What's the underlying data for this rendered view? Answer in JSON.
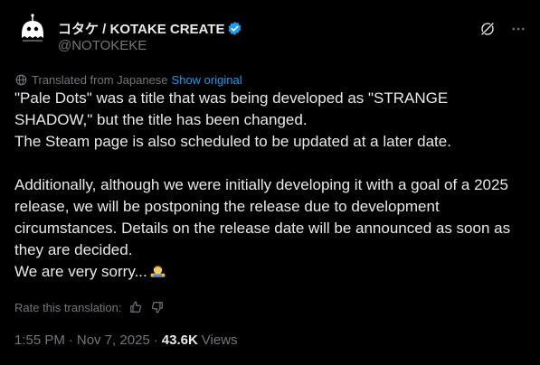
{
  "author": {
    "display_name": "コタケ / KOTAKE CREATE",
    "handle": "@NOTOKEKE",
    "verified_color": "#1d9bf0"
  },
  "translation": {
    "label": "Translated from Japanese",
    "show_original": "Show original"
  },
  "post": {
    "line1": "\"Pale Dots\" was a title that was being developed as \"STRANGE SHADOW,\" but the title has been changed.",
    "line2": "The Steam page is also scheduled to be updated at a later date.",
    "line3": "Additionally, although we were initially developing it with a goal of a 2025 release, we will be postponing the release due to development circumstances. Details on the release date will be announced as soon as they are decided.",
    "line4": "We are very sorry...",
    "emoji": "person-bowing-emoji"
  },
  "rating": {
    "label": "Rate this translation:"
  },
  "meta": {
    "time": "1:55 PM",
    "separator": "·",
    "date": "Nov 7, 2025",
    "separator2": "·",
    "views_count": "43.6K",
    "views_label": "Views"
  },
  "colors": {
    "background": "#000000",
    "text": "#e7e9ea",
    "muted": "#71767b",
    "accent": "#1d9bf0"
  }
}
